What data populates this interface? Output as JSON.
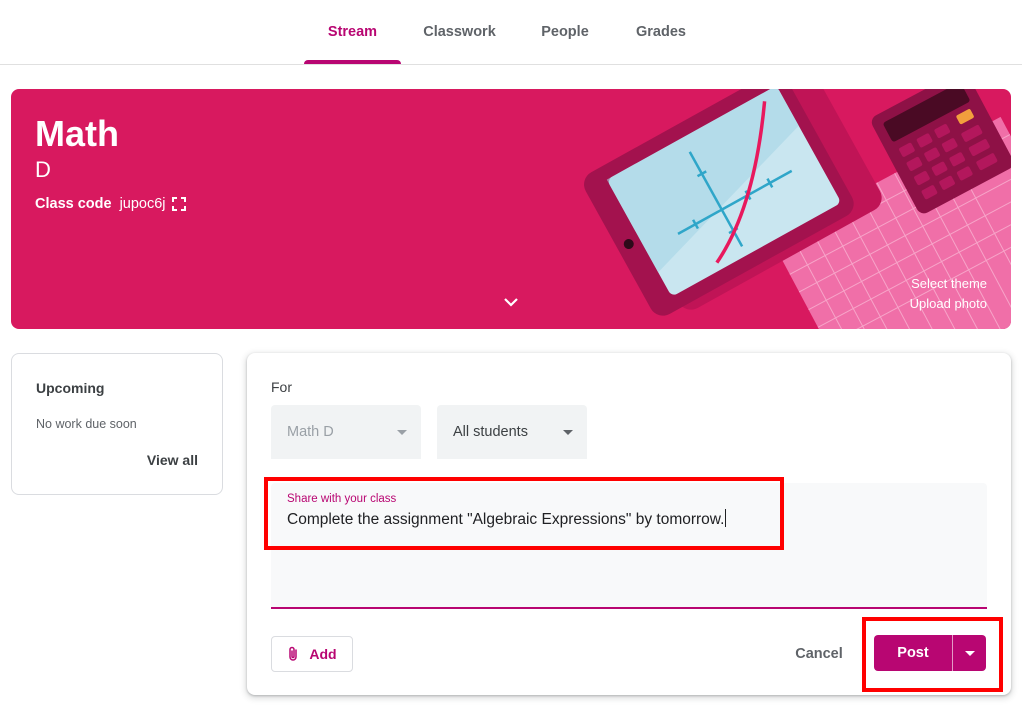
{
  "nav": {
    "tabs": [
      {
        "label": "Stream",
        "active": true
      },
      {
        "label": "Classwork",
        "active": false
      },
      {
        "label": "People",
        "active": false
      },
      {
        "label": "Grades",
        "active": false
      }
    ]
  },
  "banner": {
    "course_name": "Math",
    "section": "D",
    "class_code_label": "Class code",
    "class_code": "jupoc6j",
    "select_theme": "Select theme",
    "upload_photo": "Upload photo",
    "color": "#d8195f"
  },
  "upcoming": {
    "title": "Upcoming",
    "empty_text": "No work due soon",
    "view_all": "View all"
  },
  "composer": {
    "for_label": "For",
    "class_select": "Math D",
    "students_select": "All students",
    "field_label": "Share with your class",
    "field_value": "Complete the assignment \"Algebraic Expressions\" by tomorrow.",
    "add_label": "Add",
    "cancel_label": "Cancel",
    "post_label": "Post"
  },
  "colors": {
    "accent": "#b80672",
    "highlight": "#ff0000"
  }
}
